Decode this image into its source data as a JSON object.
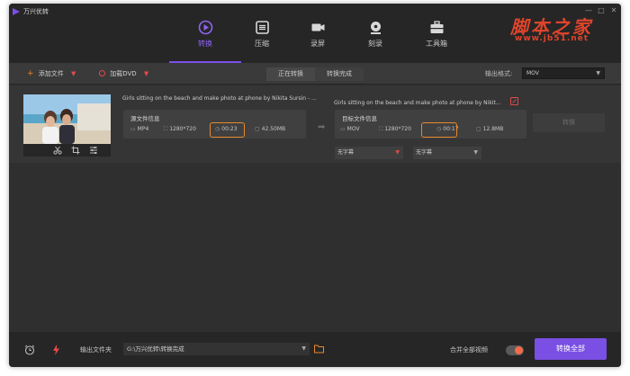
{
  "app": {
    "name": "万兴优转"
  },
  "watermark": {
    "text": "脚本之家",
    "url": "www.jb51.net"
  },
  "window_controls": {
    "minimize": "—",
    "maximize": "□",
    "close": "✕"
  },
  "nav": [
    {
      "label": "转换",
      "icon": "convert-icon",
      "active": true
    },
    {
      "label": "压缩",
      "icon": "compress-icon",
      "active": false
    },
    {
      "label": "录屏",
      "icon": "record-icon",
      "active": false
    },
    {
      "label": "刻录",
      "icon": "burn-icon",
      "active": false
    },
    {
      "label": "工具箱",
      "icon": "toolbox-icon",
      "active": false
    }
  ],
  "toolbar": {
    "add_file": "添加文件",
    "load_dvd": "加载DVD",
    "tab_converting": "正在转换",
    "tab_converted": "转换完成",
    "output_format_label": "输出格式:",
    "output_format_value": "MOV"
  },
  "file": {
    "source_name": "Girls sitting on the beach and make photo at phone by Nikita Sursin - ...",
    "source_info_title": "源文件信息",
    "source": {
      "format": "MP4",
      "resolution": "1280*720",
      "duration": "00:23",
      "size": "42.50MB"
    },
    "target_name": "Girls sitting on the beach and make photo at phone by Nikit...",
    "target_info_title": "目标文件信息",
    "target": {
      "format": "MOV",
      "resolution": "1280*720",
      "duration": "00:17",
      "size": "12.8MB"
    },
    "convert_button": "转换",
    "subtitle_1": "无字幕",
    "subtitle_2": "无字幕"
  },
  "bottom": {
    "output_folder_label": "输出文件夹",
    "output_path": "G:\\万兴优转\\转换完成",
    "merge_label": "合并全部视频",
    "merge_enabled": true,
    "convert_all": "转换全部"
  },
  "colors": {
    "accent": "#7a4fe3",
    "highlight": "#e8892c",
    "watermark": "#e0442b"
  }
}
